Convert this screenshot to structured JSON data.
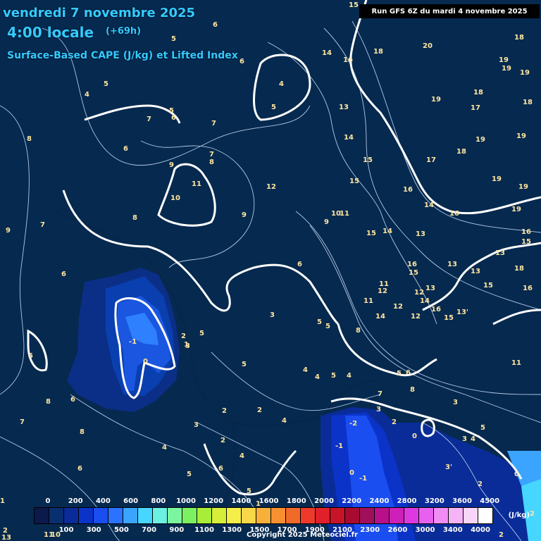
{
  "header": {
    "date": "vendredi 7 novembre 2025",
    "time": "4:00 locale",
    "lead": "(+69h)",
    "parameter": "Surface-Based CAPE (J/kg) et Lifted Index",
    "run": "Run GFS 6Z du mardi 4 novembre 2025"
  },
  "legend": {
    "top_labels": [
      "0",
      "200",
      "400",
      "600",
      "800",
      "1000",
      "1200",
      "1400",
      "1600",
      "1800",
      "2000",
      "2200",
      "2400",
      "2800",
      "3200",
      "3600",
      "4500"
    ],
    "bottom_labels": [
      "100",
      "300",
      "500",
      "700",
      "900",
      "1100",
      "1300",
      "1500",
      "1700",
      "1900",
      "2100",
      "2300",
      "2600",
      "3000",
      "3400",
      "4000"
    ],
    "unit": "(J/kg)",
    "colors": [
      "#0b1a4a",
      "#082f70",
      "#0a2c9a",
      "#0b33c8",
      "#1a4ef0",
      "#2b72ff",
      "#3aa4ff",
      "#46d6ff",
      "#6cf0e0",
      "#7cf5a0",
      "#7cf060",
      "#a8ee38",
      "#d6ee3a",
      "#f4ee48",
      "#f8d848",
      "#f8b03a",
      "#f69030",
      "#f26a2a",
      "#ee3a2a",
      "#e0202a",
      "#c81428",
      "#a80a30",
      "#a0105a",
      "#b8108a",
      "#cc20b8",
      "#dc3ae0",
      "#e860f0",
      "#f08cf4",
      "#f4b4f6",
      "#f8d6fa",
      "#ffffff"
    ]
  },
  "copyright": "Copyright 2025 Meteociel.fr",
  "lifted_index_labels": [
    "2",
    "3",
    "4",
    "5",
    "6",
    "7",
    "8",
    "9",
    "10",
    "11",
    "12",
    "13",
    "14",
    "15",
    "16",
    "17",
    "18",
    "19",
    "20",
    "-1",
    "-2",
    "0",
    "1",
    "13'",
    "14'",
    "15'",
    "16'"
  ]
}
